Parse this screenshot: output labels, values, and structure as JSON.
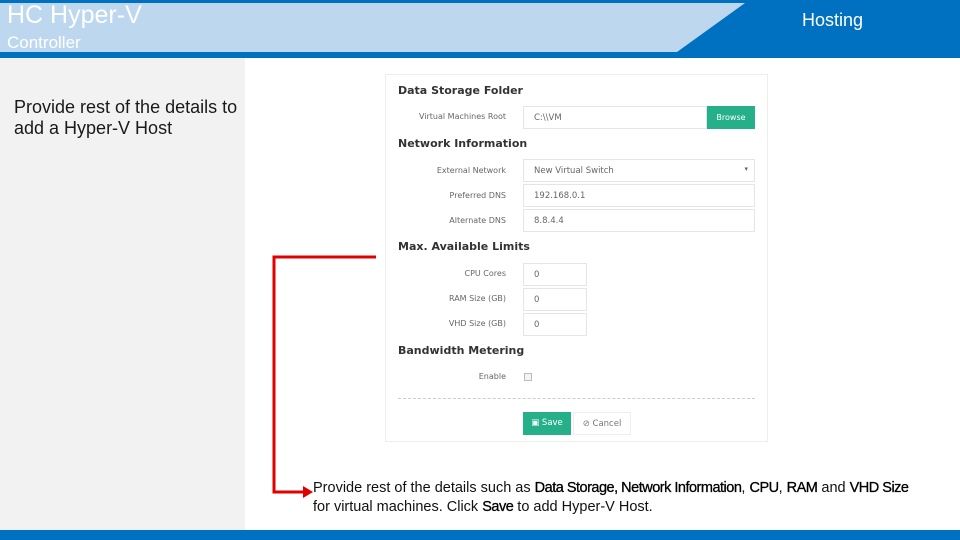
{
  "header": {
    "title": "HC Hyper-V",
    "subtitle": "Controller",
    "section": "Hosting"
  },
  "sidebar": {
    "text": "Provide rest of the details to add a Hyper-V Host"
  },
  "form": {
    "data_storage": {
      "heading": "Data Storage Folder",
      "vm_root_label": "Virtual Machines Root",
      "vm_root_value": "C:\\\\VM",
      "browse": "Browse"
    },
    "network": {
      "heading": "Network Information",
      "external_label": "External Network",
      "external_value": "New Virtual Switch",
      "pdns_label": "Preferred DNS",
      "pdns_value": "192.168.0.1",
      "adns_label": "Alternate DNS",
      "adns_value": "8.8.4.4"
    },
    "limits": {
      "heading": "Max. Available Limits",
      "cpu_label": "CPU Cores",
      "cpu_value": "0",
      "ram_label": "RAM Size (GB)",
      "ram_value": "0",
      "vhd_label": "VHD Size (GB)",
      "vhd_value": "0"
    },
    "bandwidth": {
      "heading": "Bandwidth Metering",
      "enable_label": "Enable"
    },
    "save": "Save",
    "cancel": "Cancel"
  },
  "note": {
    "p1": "Provide rest of the details such as ",
    "b1": "Data Storage, Network Information",
    "p2": ", ",
    "b2": "CPU",
    "p3": ", ",
    "b3": "RAM",
    "p4": " and ",
    "b4": "VHD Size",
    "p5": " for virtual machines. Click ",
    "b5": "Save",
    "p6": " to add Hyper-V Host."
  },
  "colors": {
    "brand": "#0070c0",
    "band": "#bdd7ee",
    "accent": "#26b08a",
    "arrow": "#e00000"
  }
}
